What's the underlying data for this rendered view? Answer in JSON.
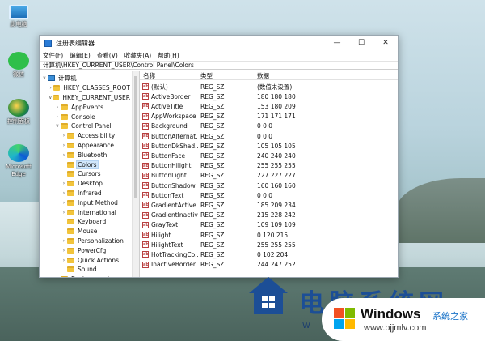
{
  "desktop": {
    "icons": [
      {
        "label": "此电脑",
        "icon": "computer-icon"
      },
      {
        "label": "微信",
        "icon": "wechat-icon"
      },
      {
        "label": "控制面板",
        "icon": "control-panel-icon"
      },
      {
        "label": "Microsoft Edge",
        "icon": "edge-icon"
      }
    ]
  },
  "window": {
    "title": "注册表编辑器",
    "controls": {
      "minimize": "—",
      "maximize": "☐",
      "close": "✕"
    },
    "menu": [
      "文件(F)",
      "编辑(E)",
      "查看(V)",
      "收藏夹(A)",
      "帮助(H)"
    ],
    "address": "计算机\\HKEY_CURRENT_USER\\Control Panel\\Colors"
  },
  "tree": [
    {
      "label": "计算机",
      "level": 0,
      "expanded": true,
      "kind": "computer"
    },
    {
      "label": "HKEY_CLASSES_ROOT",
      "level": 1,
      "expanded": false
    },
    {
      "label": "HKEY_CURRENT_USER",
      "level": 1,
      "expanded": true
    },
    {
      "label": "AppEvents",
      "level": 2,
      "expanded": false
    },
    {
      "label": "Console",
      "level": 2,
      "expanded": false
    },
    {
      "label": "Control Panel",
      "level": 2,
      "expanded": true
    },
    {
      "label": "Accessibility",
      "level": 3,
      "expanded": false
    },
    {
      "label": "Appearance",
      "level": 3,
      "expanded": false
    },
    {
      "label": "Bluetooth",
      "level": 3,
      "expanded": false
    },
    {
      "label": "Colors",
      "level": 3,
      "selected": true,
      "leaf": true
    },
    {
      "label": "Cursors",
      "level": 3,
      "leaf": true
    },
    {
      "label": "Desktop",
      "level": 3,
      "expanded": false
    },
    {
      "label": "Infrared",
      "level": 3,
      "expanded": false
    },
    {
      "label": "Input Method",
      "level": 3,
      "expanded": false
    },
    {
      "label": "International",
      "level": 3,
      "expanded": false
    },
    {
      "label": "Keyboard",
      "level": 3,
      "leaf": true
    },
    {
      "label": "Mouse",
      "level": 3,
      "leaf": true
    },
    {
      "label": "Personalization",
      "level": 3,
      "expanded": false
    },
    {
      "label": "PowerCfg",
      "level": 3,
      "expanded": false
    },
    {
      "label": "Quick Actions",
      "level": 3,
      "expanded": false
    },
    {
      "label": "Sound",
      "level": 3,
      "leaf": true
    },
    {
      "label": "Environment",
      "level": 2,
      "leaf": true
    }
  ],
  "values": {
    "headers": {
      "name": "名称",
      "type": "类型",
      "data": "数据"
    },
    "rows": [
      {
        "name": "(默认)",
        "type": "REG_SZ",
        "data": "(数值未设置)"
      },
      {
        "name": "ActiveBorder",
        "type": "REG_SZ",
        "data": "180 180 180"
      },
      {
        "name": "ActiveTitle",
        "type": "REG_SZ",
        "data": "153 180 209"
      },
      {
        "name": "AppWorkspace",
        "type": "REG_SZ",
        "data": "171 171 171"
      },
      {
        "name": "Background",
        "type": "REG_SZ",
        "data": "0 0 0"
      },
      {
        "name": "ButtonAlternat...",
        "type": "REG_SZ",
        "data": "0 0 0"
      },
      {
        "name": "ButtonDkShad...",
        "type": "REG_SZ",
        "data": "105 105 105"
      },
      {
        "name": "ButtonFace",
        "type": "REG_SZ",
        "data": "240 240 240"
      },
      {
        "name": "ButtonHilight",
        "type": "REG_SZ",
        "data": "255 255 255"
      },
      {
        "name": "ButtonLight",
        "type": "REG_SZ",
        "data": "227 227 227"
      },
      {
        "name": "ButtonShadow",
        "type": "REG_SZ",
        "data": "160 160 160"
      },
      {
        "name": "ButtonText",
        "type": "REG_SZ",
        "data": "0 0 0"
      },
      {
        "name": "GradientActive...",
        "type": "REG_SZ",
        "data": "185 209 234"
      },
      {
        "name": "GradientInactiv...",
        "type": "REG_SZ",
        "data": "215 228 242"
      },
      {
        "name": "GrayText",
        "type": "REG_SZ",
        "data": "109 109 109"
      },
      {
        "name": "Hilight",
        "type": "REG_SZ",
        "data": "0 120 215"
      },
      {
        "name": "HilightText",
        "type": "REG_SZ",
        "data": "255 255 255"
      },
      {
        "name": "HotTrackingCo...",
        "type": "REG_SZ",
        "data": "0 102 204"
      },
      {
        "name": "InactiveBorder",
        "type": "REG_SZ",
        "data": "244 247 252"
      }
    ]
  },
  "watermark": {
    "cn_title": "电脑系统网",
    "www": "W W W",
    "windows": "Windows",
    "brand": "系统之家",
    "url": "www.bjjmlv.com"
  }
}
